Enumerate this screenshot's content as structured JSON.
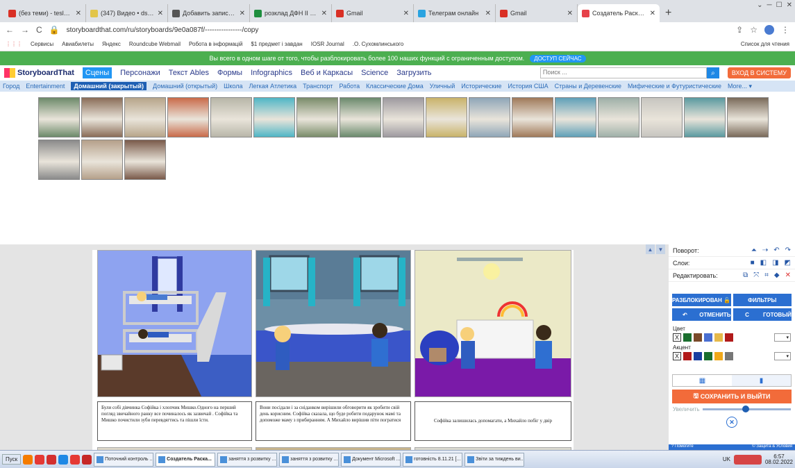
{
  "browser": {
    "tabs": [
      {
        "label": "(без теми) - teslenkovetlana",
        "color": "#d93025",
        "active": false
      },
      {
        "label": "(347) Видео • dsshkina_meti",
        "color": "#e2c54a",
        "active": false
      },
      {
        "label": "Добавить запись • Факультет",
        "color": "#555555",
        "active": false
      },
      {
        "label": "розклад ДФН ІІ сем 2021-22",
        "color": "#1e8e3e",
        "active": false
      },
      {
        "label": "Gmail",
        "color": "#d93025",
        "active": false
      },
      {
        "label": "Телеграм онлайн",
        "color": "#2aa3e0",
        "active": false
      },
      {
        "label": "Gmail",
        "color": "#d93025",
        "active": false
      },
      {
        "label": "Создатель Раскадровки | Ст",
        "color": "#e6414a",
        "active": true
      }
    ],
    "url": "storyboardthat.com/ru/storyboards/9e0a087f/----------------/copy",
    "bookmarks": [
      "Сервисы",
      "Авиабилеты",
      "Яндекс",
      "Roundcube Webmail",
      "Робота в інформацій",
      "$1 предмет і завдан",
      "IOSR Journal",
      ".О. Сухомлинського"
    ],
    "reading_list": "Список для чтения"
  },
  "promo": {
    "text": "Вы всего в одном шаге от того, чтобы разблокировать более 100 наших функций с ограниченным доступом.",
    "button": "ДОСТУП СЕЙЧАС"
  },
  "nav": {
    "logo": "StoryboardThat",
    "items": [
      "Сцены",
      "Персонажи",
      "Текст Ables",
      "Формы",
      "Infographics",
      "Веб и Каркасы",
      "Science",
      "Загрузить"
    ],
    "search_placeholder": "Поиск ...",
    "login": "ВХОД В СИСТЕМУ"
  },
  "categories": [
    "Город",
    "Entertainment",
    "Домашний (закрытый)",
    "Домашний (открытый)",
    "Школа",
    "Легкая Атлетика",
    "Транспорт",
    "Работа",
    "Классические Дома",
    "Уличный",
    "Исторические",
    "История США",
    "Страны и Деревенские",
    "Мифические и Футуристические",
    "More... ▾"
  ],
  "active_category": "Домашний (закрытый)",
  "scene_thumbs": [
    "#6d8a6a",
    "#8a6d58",
    "#b7a58a",
    "#c96b4a",
    "#b8b6a8",
    "#4fb6c6",
    "#7a8c6a",
    "#6b8a6d",
    "#9e9aa0",
    "#c9b36a",
    "#8fa6b8",
    "#a07a5a",
    "#5fa0b8",
    "#9fb0a8",
    "#c7c5c0",
    "#5a9aa0",
    "#7a6a5a",
    "#8a8a8a",
    "#b5a08a",
    "#7a5a4a"
  ],
  "storyboard": {
    "captions": [
      "Були собі дівчинка Софійка і хлопчик Мишко.Одного на перший погляд звичайного ранку все починалось як зазвичай . Софійка та Мишко почистили зуби перевдягтись та пішли їсти.",
      "Вони посідали і за сніданком вирішили обговорити як зробити свій день корисним. Софійка сказала, що буде робити подарунок мамі та допоможе маму з прибиранням. А Михайло вирішив піти погратися",
      "Софійка залишилась допомагати, а Михайло побіг у двір"
    ]
  },
  "panel": {
    "rotate": "Поворот:",
    "layers": "Слои:",
    "edit": "Редактировать:",
    "unlocked": "РАЗБЛОКИРОВАН",
    "filters": "ФИЛЬТРЫ",
    "undo": "ОТМЕНИТЬ",
    "done": "ГОТОВЫЙ",
    "color_label": "Цвет",
    "accent_label": "Акцент",
    "colors": [
      "#1a6e2e",
      "#7a4a2a",
      "#4a6fd1",
      "#e6b94a",
      "#b11a1a"
    ],
    "accents": [
      "#b11a1a",
      "#1a3fa0",
      "#1a6e2e",
      "#f0a81a",
      "#777777"
    ],
    "save": "СОХРАНИТЬ И ВЫЙТИ",
    "zoom": "Увеличить",
    "zoom_level": 0.5,
    "help": "? Помогите",
    "security": "© Защита & Условия"
  },
  "taskbar": {
    "start": "Пуск",
    "tasks": [
      "Поточний контроль ...",
      "Создатель Раска...",
      "заняття з розвитку ...",
      "заняття з розвитку ...",
      "Документ Microsoft ...",
      "готовність 8.11.21 [...",
      "Звіти за тиждень ви..."
    ],
    "active_task": 1,
    "lang": "UK",
    "time": "6:57",
    "date": "08.02.2022"
  }
}
